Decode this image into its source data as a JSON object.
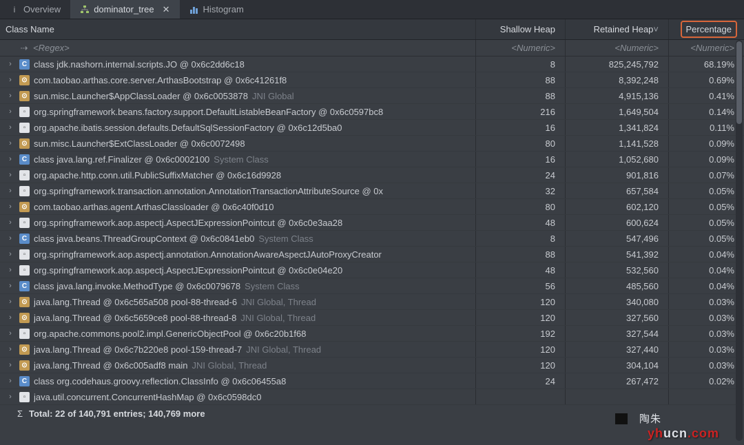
{
  "tabs": [
    {
      "label": "Overview",
      "icon": "ℹ"
    },
    {
      "label": "dominator_tree",
      "icon": "🌳",
      "active": true
    },
    {
      "label": "Histogram",
      "icon": "📊"
    }
  ],
  "headers": {
    "class_name": "Class Name",
    "shallow": "Shallow Heap",
    "retained": "Retained Heap",
    "percentage": "Percentage"
  },
  "filter": {
    "regex": "<Regex>",
    "numeric": "<Numeric>"
  },
  "rows": [
    {
      "icon": "c",
      "name": "class jdk.nashorn.internal.scripts.JO @ 0x6c2dd6c18",
      "suffix": "",
      "shallow": "8",
      "retained": "825,245,792",
      "pct": "68.19%",
      "highlight": true
    },
    {
      "icon": "o",
      "name": "com.taobao.arthas.core.server.ArthasBootstrap @ 0x6c41261f8",
      "suffix": "",
      "shallow": "88",
      "retained": "8,392,248",
      "pct": "0.69%"
    },
    {
      "icon": "o",
      "name": "sun.misc.Launcher$AppClassLoader @ 0x6c0053878",
      "suffix": "JNI Global",
      "shallow": "88",
      "retained": "4,915,136",
      "pct": "0.41%"
    },
    {
      "icon": "d",
      "name": "org.springframework.beans.factory.support.DefaultListableBeanFactory @ 0x6c0597bc8",
      "suffix": "",
      "shallow": "216",
      "retained": "1,649,504",
      "pct": "0.14%"
    },
    {
      "icon": "d",
      "name": "org.apache.ibatis.session.defaults.DefaultSqlSessionFactory @ 0x6c12d5ba0",
      "suffix": "",
      "shallow": "16",
      "retained": "1,341,824",
      "pct": "0.11%"
    },
    {
      "icon": "o",
      "name": "sun.misc.Launcher$ExtClassLoader @ 0x6c0072498",
      "suffix": "",
      "shallow": "80",
      "retained": "1,141,528",
      "pct": "0.09%"
    },
    {
      "icon": "c",
      "name": "class java.lang.ref.Finalizer @ 0x6c0002100",
      "suffix": "System Class",
      "shallow": "16",
      "retained": "1,052,680",
      "pct": "0.09%"
    },
    {
      "icon": "d",
      "name": "org.apache.http.conn.util.PublicSuffixMatcher @ 0x6c16d9928",
      "suffix": "",
      "shallow": "24",
      "retained": "901,816",
      "pct": "0.07%"
    },
    {
      "icon": "d",
      "name": "org.springframework.transaction.annotation.AnnotationTransactionAttributeSource @ 0x",
      "suffix": "",
      "shallow": "32",
      "retained": "657,584",
      "pct": "0.05%"
    },
    {
      "icon": "o",
      "name": "com.taobao.arthas.agent.ArthasClassloader @ 0x6c40f0d10",
      "suffix": "",
      "shallow": "80",
      "retained": "602,120",
      "pct": "0.05%"
    },
    {
      "icon": "d",
      "name": "org.springframework.aop.aspectj.AspectJExpressionPointcut @ 0x6c0e3aa28",
      "suffix": "",
      "shallow": "48",
      "retained": "600,624",
      "pct": "0.05%"
    },
    {
      "icon": "c",
      "name": "class java.beans.ThreadGroupContext @ 0x6c0841eb0",
      "suffix": "System Class",
      "shallow": "8",
      "retained": "547,496",
      "pct": "0.05%"
    },
    {
      "icon": "d",
      "name": "org.springframework.aop.aspectj.annotation.AnnotationAwareAspectJAutoProxyCreator",
      "suffix": "",
      "shallow": "88",
      "retained": "541,392",
      "pct": "0.04%"
    },
    {
      "icon": "d",
      "name": "org.springframework.aop.aspectj.AspectJExpressionPointcut @ 0x6c0e04e20",
      "suffix": "",
      "shallow": "48",
      "retained": "532,560",
      "pct": "0.04%"
    },
    {
      "icon": "c",
      "name": "class java.lang.invoke.MethodType @ 0x6c0079678",
      "suffix": "System Class",
      "shallow": "56",
      "retained": "485,560",
      "pct": "0.04%"
    },
    {
      "icon": "o",
      "name": "java.lang.Thread @ 0x6c565a508  pool-88-thread-6",
      "suffix": "JNI Global, Thread",
      "shallow": "120",
      "retained": "340,080",
      "pct": "0.03%"
    },
    {
      "icon": "o",
      "name": "java.lang.Thread @ 0x6c5659ce8  pool-88-thread-8",
      "suffix": "JNI Global, Thread",
      "shallow": "120",
      "retained": "327,560",
      "pct": "0.03%"
    },
    {
      "icon": "d",
      "name": "org.apache.commons.pool2.impl.GenericObjectPool @ 0x6c20b1f68",
      "suffix": "",
      "shallow": "192",
      "retained": "327,544",
      "pct": "0.03%"
    },
    {
      "icon": "o",
      "name": "java.lang.Thread @ 0x6c7b220e8  pool-159-thread-7",
      "suffix": "JNI Global, Thread",
      "shallow": "120",
      "retained": "327,440",
      "pct": "0.03%"
    },
    {
      "icon": "o",
      "name": "java.lang.Thread @ 0x6c005adf8  main",
      "suffix": "JNI Global, Thread",
      "shallow": "120",
      "retained": "304,104",
      "pct": "0.03%"
    },
    {
      "icon": "c",
      "name": "class org.codehaus.groovy.reflection.ClassInfo @ 0x6c06455a8",
      "suffix": "",
      "shallow": "24",
      "retained": "267,472",
      "pct": "0.02%"
    },
    {
      "icon": "d",
      "name": "java.util.concurrent.ConcurrentHashMap @ 0x6c0598dc0",
      "suffix": "",
      "shallow": "",
      "retained": "",
      "pct": ""
    }
  ],
  "total": "Total: 22 of 140,791 entries; 140,769 more",
  "watermark_cn": "陶朱",
  "watermark_site_a": "yh",
  "watermark_site_b": "ucn",
  "watermark_site_c": ".com"
}
